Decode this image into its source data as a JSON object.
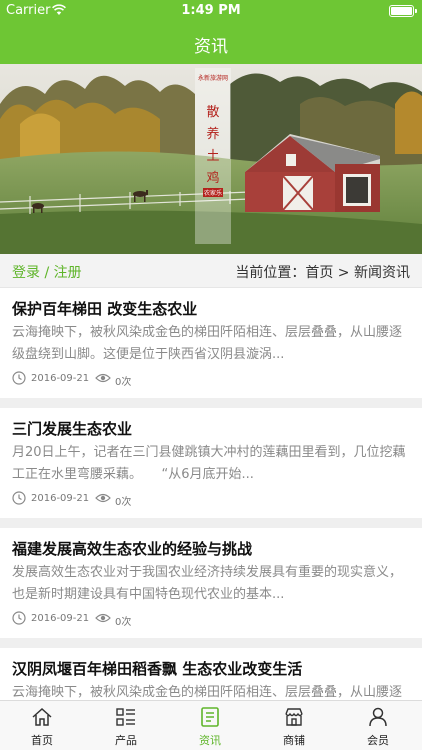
{
  "status_bar": {
    "carrier": "Carrier",
    "time": "1:49 PM"
  },
  "nav": {
    "title": "资讯"
  },
  "banner": {
    "sign_small": "永新旅游网",
    "sign_main": [
      "散",
      "养",
      "土",
      "鸡"
    ],
    "sign_tag": "农家乐"
  },
  "location": {
    "login": "登录",
    "divider": " / ",
    "register": "注册",
    "prefix": "当前位置：",
    "home": "首页",
    "arrow": " > ",
    "current": "新闻资讯"
  },
  "articles": [
    {
      "title": "保护百年梯田 改变生态农业",
      "excerpt": "云海掩映下，被秋风染成金色的梯田阡陌相连、层层叠叠，从山腰逐级盘绕到山脚。这便是位于陕西省汉阴县漩涡...",
      "date": "2016-09-21",
      "views": "0次"
    },
    {
      "title": "三门发展生态农业",
      "excerpt": "月20日上午，记者在三门县健跳镇大冲村的莲藕田里看到，几位挖藕工正在水里弯腰采藕。　　“从6月底开始...",
      "date": "2016-09-21",
      "views": "0次"
    },
    {
      "title": "福建发展高效生态农业的经验与挑战",
      "excerpt": "发展高效生态农业对于我国农业经济持续发展具有重要的现实意义，也是新时期建设具有中国特色现代农业的基本...",
      "date": "2016-09-21",
      "views": "0次"
    },
    {
      "title": "汉阴凤堰百年梯田稻香飘 生态农业改变生活",
      "excerpt": "云海掩映下，被秋风染成金色的梯田阡陌相连、层层叠叠，从山腰逐级盘绕到山脚。",
      "date": "2016-09-21",
      "views": "0次"
    }
  ],
  "tabs": [
    {
      "label": "首页",
      "icon": "home-icon"
    },
    {
      "label": "产品",
      "icon": "grid-list-icon"
    },
    {
      "label": "资讯",
      "icon": "document-icon"
    },
    {
      "label": "商铺",
      "icon": "store-icon"
    },
    {
      "label": "会员",
      "icon": "user-icon"
    }
  ],
  "colors": {
    "brand_green": "#6ec634",
    "active_tab": "#5fb52a"
  }
}
